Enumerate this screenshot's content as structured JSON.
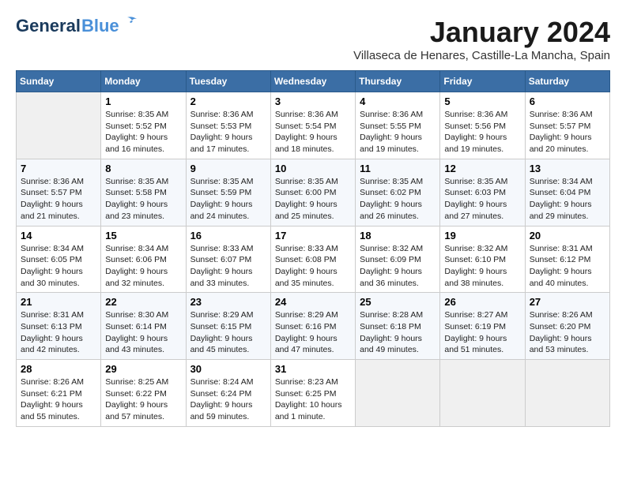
{
  "header": {
    "logo_general": "General",
    "logo_blue": "Blue",
    "month": "January 2024",
    "location": "Villaseca de Henares, Castille-La Mancha, Spain"
  },
  "days_of_week": [
    "Sunday",
    "Monday",
    "Tuesday",
    "Wednesday",
    "Thursday",
    "Friday",
    "Saturday"
  ],
  "weeks": [
    [
      {
        "day": "",
        "sunrise": "",
        "sunset": "",
        "daylight": ""
      },
      {
        "day": "1",
        "sunrise": "Sunrise: 8:35 AM",
        "sunset": "Sunset: 5:52 PM",
        "daylight": "Daylight: 9 hours and 16 minutes."
      },
      {
        "day": "2",
        "sunrise": "Sunrise: 8:36 AM",
        "sunset": "Sunset: 5:53 PM",
        "daylight": "Daylight: 9 hours and 17 minutes."
      },
      {
        "day": "3",
        "sunrise": "Sunrise: 8:36 AM",
        "sunset": "Sunset: 5:54 PM",
        "daylight": "Daylight: 9 hours and 18 minutes."
      },
      {
        "day": "4",
        "sunrise": "Sunrise: 8:36 AM",
        "sunset": "Sunset: 5:55 PM",
        "daylight": "Daylight: 9 hours and 19 minutes."
      },
      {
        "day": "5",
        "sunrise": "Sunrise: 8:36 AM",
        "sunset": "Sunset: 5:56 PM",
        "daylight": "Daylight: 9 hours and 19 minutes."
      },
      {
        "day": "6",
        "sunrise": "Sunrise: 8:36 AM",
        "sunset": "Sunset: 5:57 PM",
        "daylight": "Daylight: 9 hours and 20 minutes."
      }
    ],
    [
      {
        "day": "7",
        "sunrise": "Sunrise: 8:36 AM",
        "sunset": "Sunset: 5:57 PM",
        "daylight": "Daylight: 9 hours and 21 minutes."
      },
      {
        "day": "8",
        "sunrise": "Sunrise: 8:35 AM",
        "sunset": "Sunset: 5:58 PM",
        "daylight": "Daylight: 9 hours and 23 minutes."
      },
      {
        "day": "9",
        "sunrise": "Sunrise: 8:35 AM",
        "sunset": "Sunset: 5:59 PM",
        "daylight": "Daylight: 9 hours and 24 minutes."
      },
      {
        "day": "10",
        "sunrise": "Sunrise: 8:35 AM",
        "sunset": "Sunset: 6:00 PM",
        "daylight": "Daylight: 9 hours and 25 minutes."
      },
      {
        "day": "11",
        "sunrise": "Sunrise: 8:35 AM",
        "sunset": "Sunset: 6:02 PM",
        "daylight": "Daylight: 9 hours and 26 minutes."
      },
      {
        "day": "12",
        "sunrise": "Sunrise: 8:35 AM",
        "sunset": "Sunset: 6:03 PM",
        "daylight": "Daylight: 9 hours and 27 minutes."
      },
      {
        "day": "13",
        "sunrise": "Sunrise: 8:34 AM",
        "sunset": "Sunset: 6:04 PM",
        "daylight": "Daylight: 9 hours and 29 minutes."
      }
    ],
    [
      {
        "day": "14",
        "sunrise": "Sunrise: 8:34 AM",
        "sunset": "Sunset: 6:05 PM",
        "daylight": "Daylight: 9 hours and 30 minutes."
      },
      {
        "day": "15",
        "sunrise": "Sunrise: 8:34 AM",
        "sunset": "Sunset: 6:06 PM",
        "daylight": "Daylight: 9 hours and 32 minutes."
      },
      {
        "day": "16",
        "sunrise": "Sunrise: 8:33 AM",
        "sunset": "Sunset: 6:07 PM",
        "daylight": "Daylight: 9 hours and 33 minutes."
      },
      {
        "day": "17",
        "sunrise": "Sunrise: 8:33 AM",
        "sunset": "Sunset: 6:08 PM",
        "daylight": "Daylight: 9 hours and 35 minutes."
      },
      {
        "day": "18",
        "sunrise": "Sunrise: 8:32 AM",
        "sunset": "Sunset: 6:09 PM",
        "daylight": "Daylight: 9 hours and 36 minutes."
      },
      {
        "day": "19",
        "sunrise": "Sunrise: 8:32 AM",
        "sunset": "Sunset: 6:10 PM",
        "daylight": "Daylight: 9 hours and 38 minutes."
      },
      {
        "day": "20",
        "sunrise": "Sunrise: 8:31 AM",
        "sunset": "Sunset: 6:12 PM",
        "daylight": "Daylight: 9 hours and 40 minutes."
      }
    ],
    [
      {
        "day": "21",
        "sunrise": "Sunrise: 8:31 AM",
        "sunset": "Sunset: 6:13 PM",
        "daylight": "Daylight: 9 hours and 42 minutes."
      },
      {
        "day": "22",
        "sunrise": "Sunrise: 8:30 AM",
        "sunset": "Sunset: 6:14 PM",
        "daylight": "Daylight: 9 hours and 43 minutes."
      },
      {
        "day": "23",
        "sunrise": "Sunrise: 8:29 AM",
        "sunset": "Sunset: 6:15 PM",
        "daylight": "Daylight: 9 hours and 45 minutes."
      },
      {
        "day": "24",
        "sunrise": "Sunrise: 8:29 AM",
        "sunset": "Sunset: 6:16 PM",
        "daylight": "Daylight: 9 hours and 47 minutes."
      },
      {
        "day": "25",
        "sunrise": "Sunrise: 8:28 AM",
        "sunset": "Sunset: 6:18 PM",
        "daylight": "Daylight: 9 hours and 49 minutes."
      },
      {
        "day": "26",
        "sunrise": "Sunrise: 8:27 AM",
        "sunset": "Sunset: 6:19 PM",
        "daylight": "Daylight: 9 hours and 51 minutes."
      },
      {
        "day": "27",
        "sunrise": "Sunrise: 8:26 AM",
        "sunset": "Sunset: 6:20 PM",
        "daylight": "Daylight: 9 hours and 53 minutes."
      }
    ],
    [
      {
        "day": "28",
        "sunrise": "Sunrise: 8:26 AM",
        "sunset": "Sunset: 6:21 PM",
        "daylight": "Daylight: 9 hours and 55 minutes."
      },
      {
        "day": "29",
        "sunrise": "Sunrise: 8:25 AM",
        "sunset": "Sunset: 6:22 PM",
        "daylight": "Daylight: 9 hours and 57 minutes."
      },
      {
        "day": "30",
        "sunrise": "Sunrise: 8:24 AM",
        "sunset": "Sunset: 6:24 PM",
        "daylight": "Daylight: 9 hours and 59 minutes."
      },
      {
        "day": "31",
        "sunrise": "Sunrise: 8:23 AM",
        "sunset": "Sunset: 6:25 PM",
        "daylight": "Daylight: 10 hours and 1 minute."
      },
      {
        "day": "",
        "sunrise": "",
        "sunset": "",
        "daylight": ""
      },
      {
        "day": "",
        "sunrise": "",
        "sunset": "",
        "daylight": ""
      },
      {
        "day": "",
        "sunrise": "",
        "sunset": "",
        "daylight": ""
      }
    ]
  ]
}
